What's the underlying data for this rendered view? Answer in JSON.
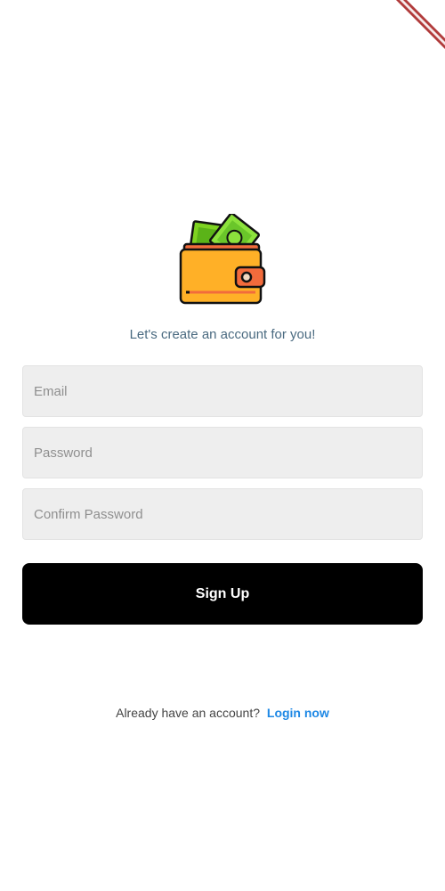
{
  "header": {
    "subtitle": "Let's create an account for you!"
  },
  "form": {
    "email": {
      "placeholder": "Email",
      "value": ""
    },
    "password": {
      "placeholder": "Password",
      "value": ""
    },
    "confirm_password": {
      "placeholder": "Confirm Password",
      "value": ""
    },
    "signup_label": "Sign Up"
  },
  "footer": {
    "prompt": "Already have an account?",
    "login_label": "Login now"
  },
  "icons": {
    "logo": "wallet-icon",
    "banner": "debug-banner-icon"
  },
  "colors": {
    "button_bg": "#000000",
    "link": "#1e88e5",
    "field_bg": "#eeeeee",
    "wallet_body": "#FFB027",
    "wallet_flap": "#F26B3C",
    "cash": "#7ED321",
    "banner": "#B13B3B"
  }
}
